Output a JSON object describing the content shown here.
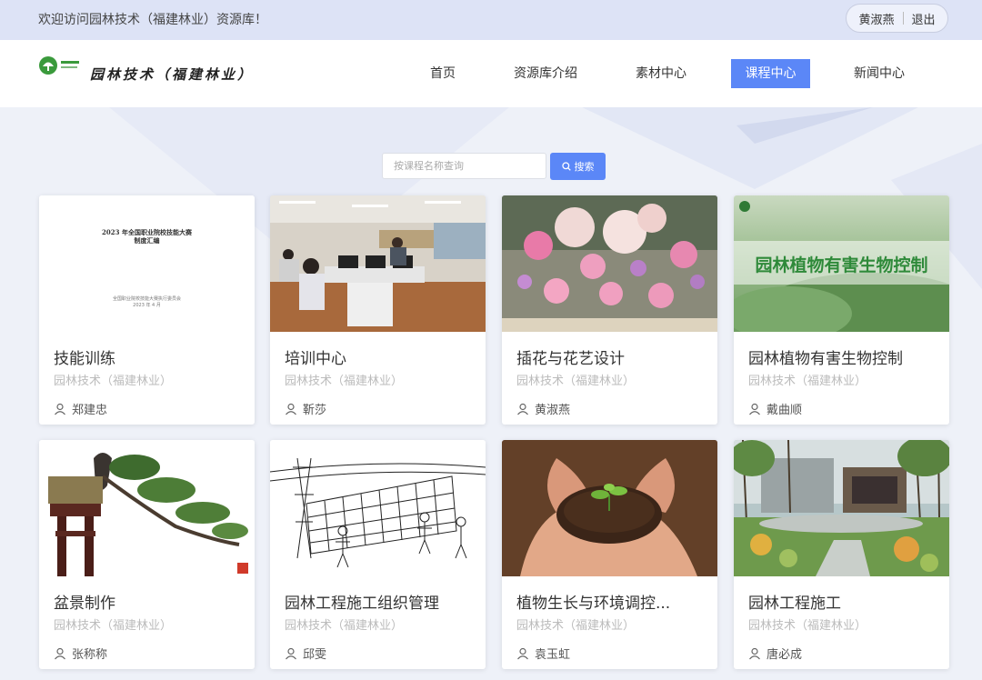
{
  "topbar": {
    "welcome": "欢迎访问园林技术（福建林业）资源库！",
    "user_name": "黄淑燕",
    "logout": "退出"
  },
  "header": {
    "logo_text": "园林技术（福建林业）",
    "nav": [
      {
        "label": "首页",
        "active": false
      },
      {
        "label": "资源库介绍",
        "active": false
      },
      {
        "label": "素材中心",
        "active": false
      },
      {
        "label": "课程中心",
        "active": true
      },
      {
        "label": "新闻中心",
        "active": false
      }
    ]
  },
  "search": {
    "placeholder": "按课程名称查询",
    "button_label": "搜索"
  },
  "cards": [
    {
      "title": "技能训练",
      "subtitle": "园林技术（福建林业）",
      "teacher": "郑建忠",
      "thumb": "document-cover",
      "thumb_text": [
        "2023 年全国职业院校技能大赛",
        "制度汇编",
        "全国职业院校技能大赛执行委员会",
        "2023 年 4 月"
      ]
    },
    {
      "title": "培训中心",
      "subtitle": "园林技术（福建林业）",
      "teacher": "靳莎",
      "thumb": "classroom-photo"
    },
    {
      "title": "插花与花艺设计",
      "subtitle": "园林技术（福建林业）",
      "teacher": "黄淑燕",
      "thumb": "flower-bouquet-photo"
    },
    {
      "title": "园林植物有害生物控制",
      "subtitle": "园林技术（福建林业）",
      "teacher": "戴曲顺",
      "thumb": "leaf-banner",
      "thumb_text": [
        "园林植物有害生物控制"
      ]
    },
    {
      "title": "盆景制作",
      "subtitle": "园林技术（福建林业）",
      "teacher": "张称称",
      "thumb": "bonsai-photo"
    },
    {
      "title": "园林工程施工组织管理",
      "subtitle": "园林技术（福建林业）",
      "teacher": "邱雯",
      "thumb": "construction-sketch"
    },
    {
      "title": "植物生长与环境调控...",
      "subtitle": "园林技术（福建林业）",
      "teacher": "袁玉虹",
      "thumb": "seedling-hands-photo"
    },
    {
      "title": "园林工程施工",
      "subtitle": "园林技术（福建林业）",
      "teacher": "唐必成",
      "thumb": "garden-photo"
    }
  ],
  "colors": {
    "accent": "#5b87f7",
    "topbar_bg": "#dde3f6"
  }
}
